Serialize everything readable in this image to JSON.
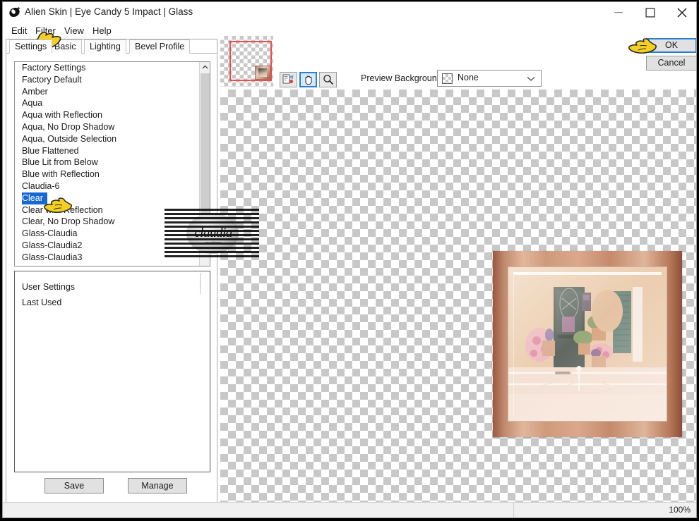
{
  "window": {
    "title": "Alien Skin | Eye Candy 5 Impact | Glass",
    "app_icon": "alien-skin-logo-icon",
    "controls": {
      "minimize": "minimize-icon",
      "maximize": "maximize-icon",
      "close": "close-icon"
    }
  },
  "menu": {
    "items": [
      {
        "label": "Edit"
      },
      {
        "label": "Filter"
      },
      {
        "label": "View"
      },
      {
        "label": "Help"
      }
    ]
  },
  "tabs": [
    {
      "label": "Settings",
      "active": true
    },
    {
      "label": "Basic",
      "active": false
    },
    {
      "label": "Lighting",
      "active": false
    },
    {
      "label": "Bevel Profile",
      "active": false
    }
  ],
  "settings_list": {
    "items": [
      "Factory Settings",
      "Factory Default",
      "Amber",
      "Aqua",
      "Aqua with Reflection",
      "Aqua, No Drop Shadow",
      "Aqua, Outside Selection",
      "Blue Flattened",
      "Blue Lit from Below",
      "Blue with Reflection",
      "Claudia-6",
      "Clear",
      "Clear with Reflection",
      "Clear, No Drop Shadow",
      "Glass-Claudia",
      "Glass-Claudia2",
      "Glass-Claudia3"
    ],
    "selected": "Clear",
    "selected_index": 11,
    "selection_color": "#1669d4"
  },
  "user_settings_list": {
    "items": [
      "User Settings",
      "Last Used"
    ]
  },
  "buttons": {
    "save": "Save",
    "manage": "Manage",
    "ok": "OK",
    "cancel": "Cancel"
  },
  "toolbar": {
    "tools": [
      {
        "name": "color-picker-icon",
        "active": false
      },
      {
        "name": "hand-icon",
        "active": true
      },
      {
        "name": "zoom-icon",
        "active": false
      }
    ],
    "preview_background_label": "Preview Background:",
    "preview_background_value": "None",
    "preview_background_options": [
      "None"
    ]
  },
  "canvas": {
    "watermark_text": "claudia",
    "watermark_subtext": "creations"
  },
  "statusbar": {
    "zoom": "100%"
  },
  "colors": {
    "accent": "#2a7fd4",
    "selection": "#1669d4",
    "navigator_viewport": "#ee4b4b",
    "button_face": "#e1e1e1"
  }
}
